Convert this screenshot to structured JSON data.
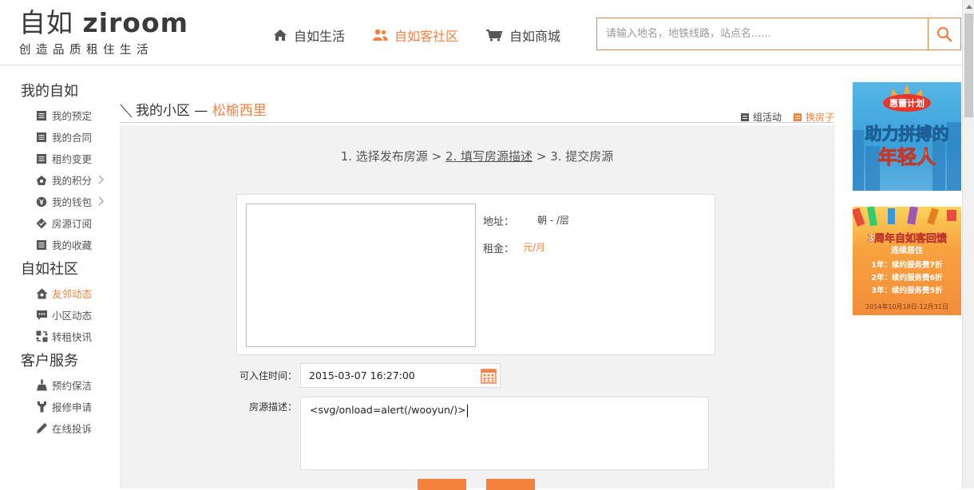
{
  "header": {
    "logo_brand_cn": "自如",
    "logo_brand_en": "ziroom",
    "logo_slogan": "创造品质租住生活",
    "nav": [
      {
        "label": "自如生活",
        "icon": "home-icon",
        "active": false
      },
      {
        "label": "自如客社区",
        "icon": "users-icon",
        "active": true
      },
      {
        "label": "自如商城",
        "icon": "cart-icon",
        "active": false
      }
    ],
    "search_placeholder": "请输入地名，地铁线路，站点名......",
    "accent": "#f5813f"
  },
  "sidebar": {
    "groups": [
      {
        "title": "我的自如",
        "items": [
          {
            "label": "我的预定",
            "icon": "document-icon"
          },
          {
            "label": "我的合同",
            "icon": "document-icon"
          },
          {
            "label": "租约变更",
            "icon": "document-icon"
          },
          {
            "label": "我的积分",
            "icon": "gift-icon",
            "chevron": true
          },
          {
            "label": "我的钱包",
            "icon": "wallet-icon",
            "chevron": true
          },
          {
            "label": "房源订阅",
            "icon": "diamond-icon"
          },
          {
            "label": "我的收藏",
            "icon": "document-icon"
          }
        ]
      },
      {
        "title": "自如社区",
        "items": [
          {
            "label": "友邻动态",
            "icon": "house-icon",
            "active": true
          },
          {
            "label": "小区动态",
            "icon": "chat-icon"
          },
          {
            "label": "转租快讯",
            "icon": "exchange-icon"
          }
        ]
      },
      {
        "title": "客户服务",
        "items": [
          {
            "label": "预约保洁",
            "icon": "broom-icon"
          },
          {
            "label": "报修申请",
            "icon": "wrench-icon"
          },
          {
            "label": "在线投诉",
            "icon": "pen-icon"
          }
        ]
      }
    ]
  },
  "main": {
    "title_prefix": "我的小区 — ",
    "community": "松榆西里",
    "links": [
      {
        "label": "组活动",
        "icon": "activity-icon"
      },
      {
        "label": "换房子",
        "icon": "switch-house-icon"
      }
    ],
    "steps": {
      "s1": "1. 选择发布房源",
      "sep": ">",
      "s2": "2. 填写房源描述",
      "s3": "3. 提交房源"
    },
    "house": {
      "address_label": "地址：",
      "address_value": "朝 - /层",
      "rent_label": "租金：",
      "rent_value": "元/月"
    },
    "form": {
      "checkin_label": "可入住时间：",
      "checkin_value": "2015-03-07 16:27:00",
      "desc_label": "房源描述：",
      "desc_value": "<svg/onload=alert(/wooyun/)>"
    }
  },
  "ads": [
    {
      "line1": "惠蕾计划",
      "line2": "助力拼搏的",
      "line3": "年轻人"
    },
    {
      "line1": "3周年自如客回馈",
      "line2": "连续居住",
      "tiers": [
        "1年：续约服务费7折",
        "2年：续约服务费6折",
        "3年：续约服务费5折"
      ],
      "dates": "2014年10月18日-12月31日"
    }
  ]
}
